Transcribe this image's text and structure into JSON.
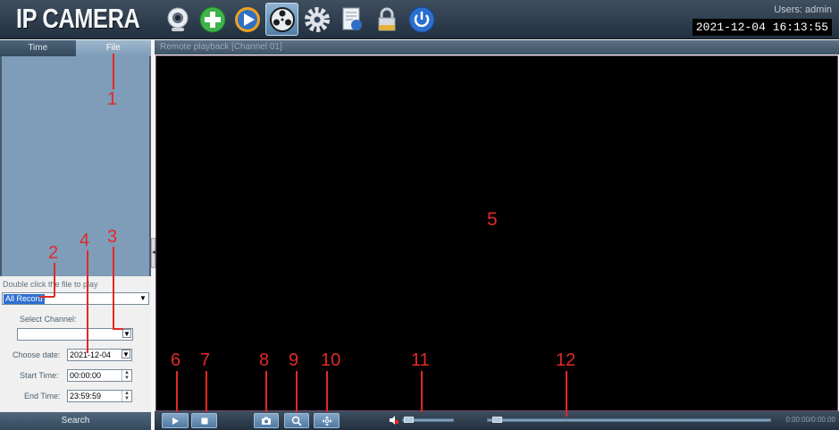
{
  "header": {
    "logo": "IP CAMERA",
    "users_label": "Users: admin",
    "datetime": "2021-12-04 16:13:55",
    "icons": [
      "webcam-icon",
      "add-icon",
      "play-icon",
      "playback-icon",
      "settings-icon",
      "log-icon",
      "lock-icon",
      "power-icon"
    ],
    "active_icon": "playback-icon"
  },
  "left_panel": {
    "tabs": [
      {
        "label": "Time"
      },
      {
        "label": "File"
      }
    ],
    "active_tab": "File",
    "hint": "Double click the file to play",
    "record_type": "All Record",
    "select_channel_label": "Select Channel:",
    "channel_value": "",
    "choose_date_label": "Choose date:",
    "date_value": "2021-12-04",
    "start_time_label": "Start Time:",
    "start_time_value": "00:00:00",
    "end_time_label": "End Time:",
    "end_time_value": "23:59:59",
    "search_label": "Search"
  },
  "playback": {
    "title": "Remote playback [Channel 01]",
    "time_display": "0:00:00/0:00:00",
    "volume_level": 0.05,
    "progress": 0.02
  },
  "annotations": [
    "1",
    "2",
    "3",
    "4",
    "5",
    "6",
    "7",
    "8",
    "9",
    "10",
    "11",
    "12"
  ],
  "colors": {
    "annotation": "#e02a28",
    "video_background": "#000000",
    "panel_background": "#4a5c6e",
    "active_icon_background": "#6f98be"
  }
}
